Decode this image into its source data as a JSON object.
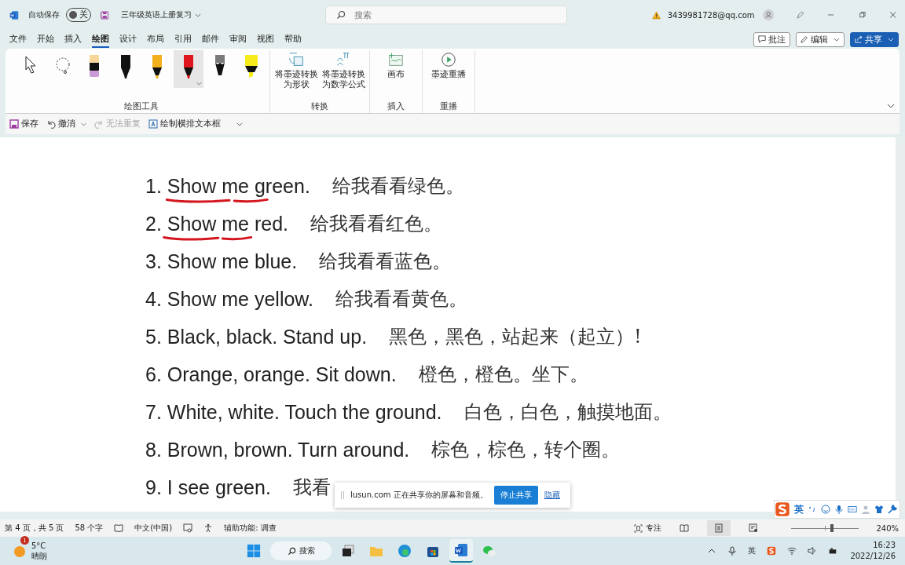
{
  "title_bar": {
    "autosave_label": "自动保存",
    "autosave": {
      "on": false,
      "label": "关"
    },
    "document_title": "三年级英语上册复习",
    "search_placeholder": "搜索",
    "account": "3439981728@qq.com"
  },
  "menu_tabs": [
    {
      "label": "文件",
      "selected": false
    },
    {
      "label": "开始",
      "selected": false
    },
    {
      "label": "插入",
      "selected": false
    },
    {
      "label": "绘图",
      "selected": true
    },
    {
      "label": "设计",
      "selected": false
    },
    {
      "label": "布局",
      "selected": false
    },
    {
      "label": "引用",
      "selected": false
    },
    {
      "label": "邮件",
      "selected": false
    },
    {
      "label": "审阅",
      "selected": false
    },
    {
      "label": "视图",
      "selected": false
    },
    {
      "label": "帮助",
      "selected": false
    }
  ],
  "action_buttons": [
    {
      "kind": "comment",
      "label": "批注"
    },
    {
      "kind": "edit",
      "label": "编辑"
    },
    {
      "kind": "share",
      "label": "共享"
    }
  ],
  "ribbon": {
    "groups": [
      {
        "label": "绘图工具",
        "tools": [
          {
            "kind": "select",
            "selected": false
          },
          {
            "kind": "lasso",
            "selected": false
          },
          {
            "kind": "eraser",
            "color": "#c99ad6",
            "selected": false
          },
          {
            "kind": "pen",
            "color": "#111111",
            "selected": false
          },
          {
            "kind": "pen",
            "color": "#f2b01c",
            "selected": false
          },
          {
            "kind": "pen",
            "color": "#e0161e",
            "selected": true
          },
          {
            "kind": "pencil",
            "color": "#7a7a7a",
            "selected": false
          },
          {
            "kind": "highlighter",
            "color": "#f7ec1b",
            "selected": false
          }
        ]
      },
      {
        "label": "转换",
        "buttons": [
          {
            "kind": "shape",
            "label": "将墨迹转换为形状"
          },
          {
            "kind": "math",
            "label": "将墨迹转换为数学公式"
          }
        ]
      },
      {
        "label": "插入",
        "buttons": [
          {
            "kind": "canvas",
            "label": "画布"
          }
        ]
      },
      {
        "label": "重播",
        "buttons": [
          {
            "kind": "replay",
            "label": "墨迹重播"
          }
        ]
      }
    ]
  },
  "quick_access": [
    {
      "kind": "save",
      "label": "保存",
      "disabled": false
    },
    {
      "kind": "undo",
      "label": "撤消",
      "disabled": false
    },
    {
      "kind": "redo",
      "label": "无法重复",
      "disabled": true
    },
    {
      "kind": "textbox",
      "label": "绘制横排文本框",
      "disabled": false
    }
  ],
  "document": {
    "lines": [
      {
        "english": "1. Show me green.",
        "chinese": "给我看看绿色。",
        "ink_underline": true
      },
      {
        "english": "2. Show me red.",
        "chinese": "给我看看红色。",
        "ink_underline": true
      },
      {
        "english": "3. Show me blue.",
        "chinese": "给我看看蓝色。",
        "ink_underline": false
      },
      {
        "english": "4. Show me yellow.",
        "chinese": "给我看看黄色。",
        "ink_underline": false
      },
      {
        "english": "5. Black, black. Stand up.",
        "chinese": "黑色，黑色，站起来（起立）!",
        "ink_underline": false
      },
      {
        "english": "6. Orange, orange. Sit down.",
        "chinese": "橙色，橙色。坐下。",
        "ink_underline": false
      },
      {
        "english": "7. White, white. Touch the ground.",
        "chinese": "白色，白色，触摸地面。",
        "ink_underline": false
      },
      {
        "english": "8. Brown, brown. Turn around.",
        "chinese": "棕色，棕色，转个圈。",
        "ink_underline": false
      },
      {
        "english": "9. I see green.",
        "chinese": "我看",
        "ink_underline": false
      }
    ]
  },
  "share_notice": {
    "text": "lusun.com 正在共享你的屏幕和音频。",
    "button": "停止共享",
    "link": "隐藏"
  },
  "ime_bar": {
    "mode": "英"
  },
  "status_bar": {
    "left": [
      "第 4 页，共 5 页",
      "58 个字",
      "中文(中国)",
      "辅助功能: 调查"
    ],
    "focus": "专注",
    "zoom": {
      "level": 0.6,
      "label": "240%"
    }
  },
  "taskbar": {
    "weather": {
      "badge": "1",
      "temperature": "5°C",
      "condition": "晴朗"
    },
    "search": "搜索",
    "apps": [
      {
        "kind": "taskview",
        "selected": false
      },
      {
        "kind": "folder",
        "selected": false
      },
      {
        "kind": "edge",
        "selected": false
      },
      {
        "kind": "store",
        "selected": false
      },
      {
        "kind": "word",
        "selected": true
      },
      {
        "kind": "wechat",
        "selected": false
      }
    ],
    "tray_ime": "英",
    "time": "16:23",
    "date": "2022/12/26"
  }
}
